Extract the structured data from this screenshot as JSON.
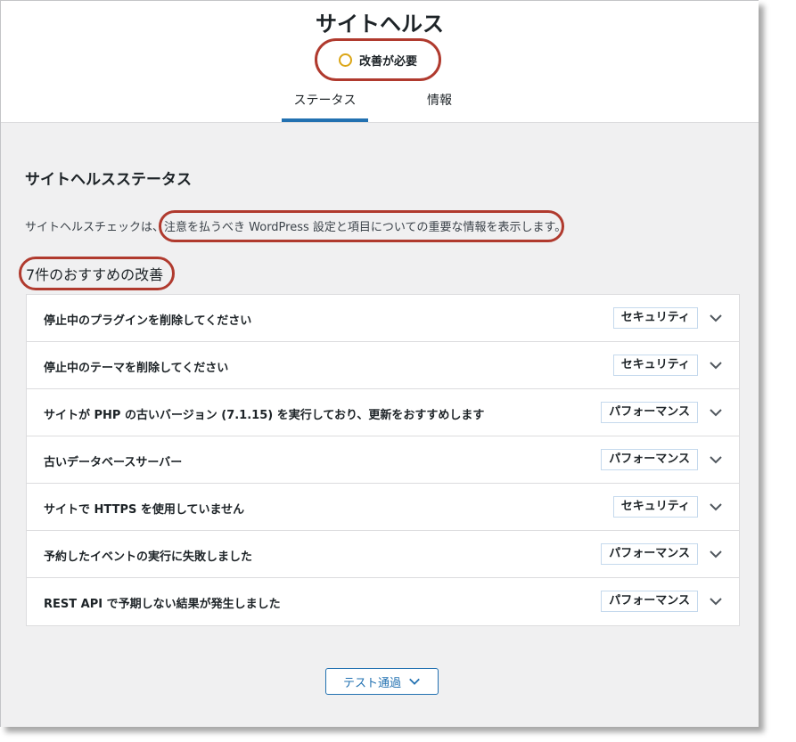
{
  "header": {
    "title": "サイトヘルス",
    "status_label": "改善が必要",
    "tabs": [
      {
        "label": "ステータス"
      },
      {
        "label": "情報"
      }
    ]
  },
  "main": {
    "section_title": "サイトヘルスステータス",
    "description_prefix": "サイトヘルスチェックは、",
    "description_highlight": "注意を払うべき WordPress 設定と項目についての重要な情報を表示します。",
    "count_label": "7件のおすすめの改善",
    "issues": [
      {
        "label": "停止中のプラグインを削除してください",
        "badge": "セキュリティ"
      },
      {
        "label": "停止中のテーマを削除してください",
        "badge": "セキュリティ"
      },
      {
        "label": "サイトが PHP の古いバージョン (7.1.15) を実行しており、更新をおすすめします",
        "badge": "パフォーマンス"
      },
      {
        "label": "古いデータベースサーバー",
        "badge": "パフォーマンス"
      },
      {
        "label": "サイトで HTTPS を使用していません",
        "badge": "セキュリティ"
      },
      {
        "label": "予約したイベントの実行に失敗しました",
        "badge": "パフォーマンス"
      },
      {
        "label": "REST API で予期しない結果が発生しました",
        "badge": "パフォーマンス"
      }
    ],
    "passed_button": "テスト通過"
  },
  "colors": {
    "accent": "#2271b1",
    "status_warning": "#dba617",
    "annotation": "#b03a2e"
  }
}
